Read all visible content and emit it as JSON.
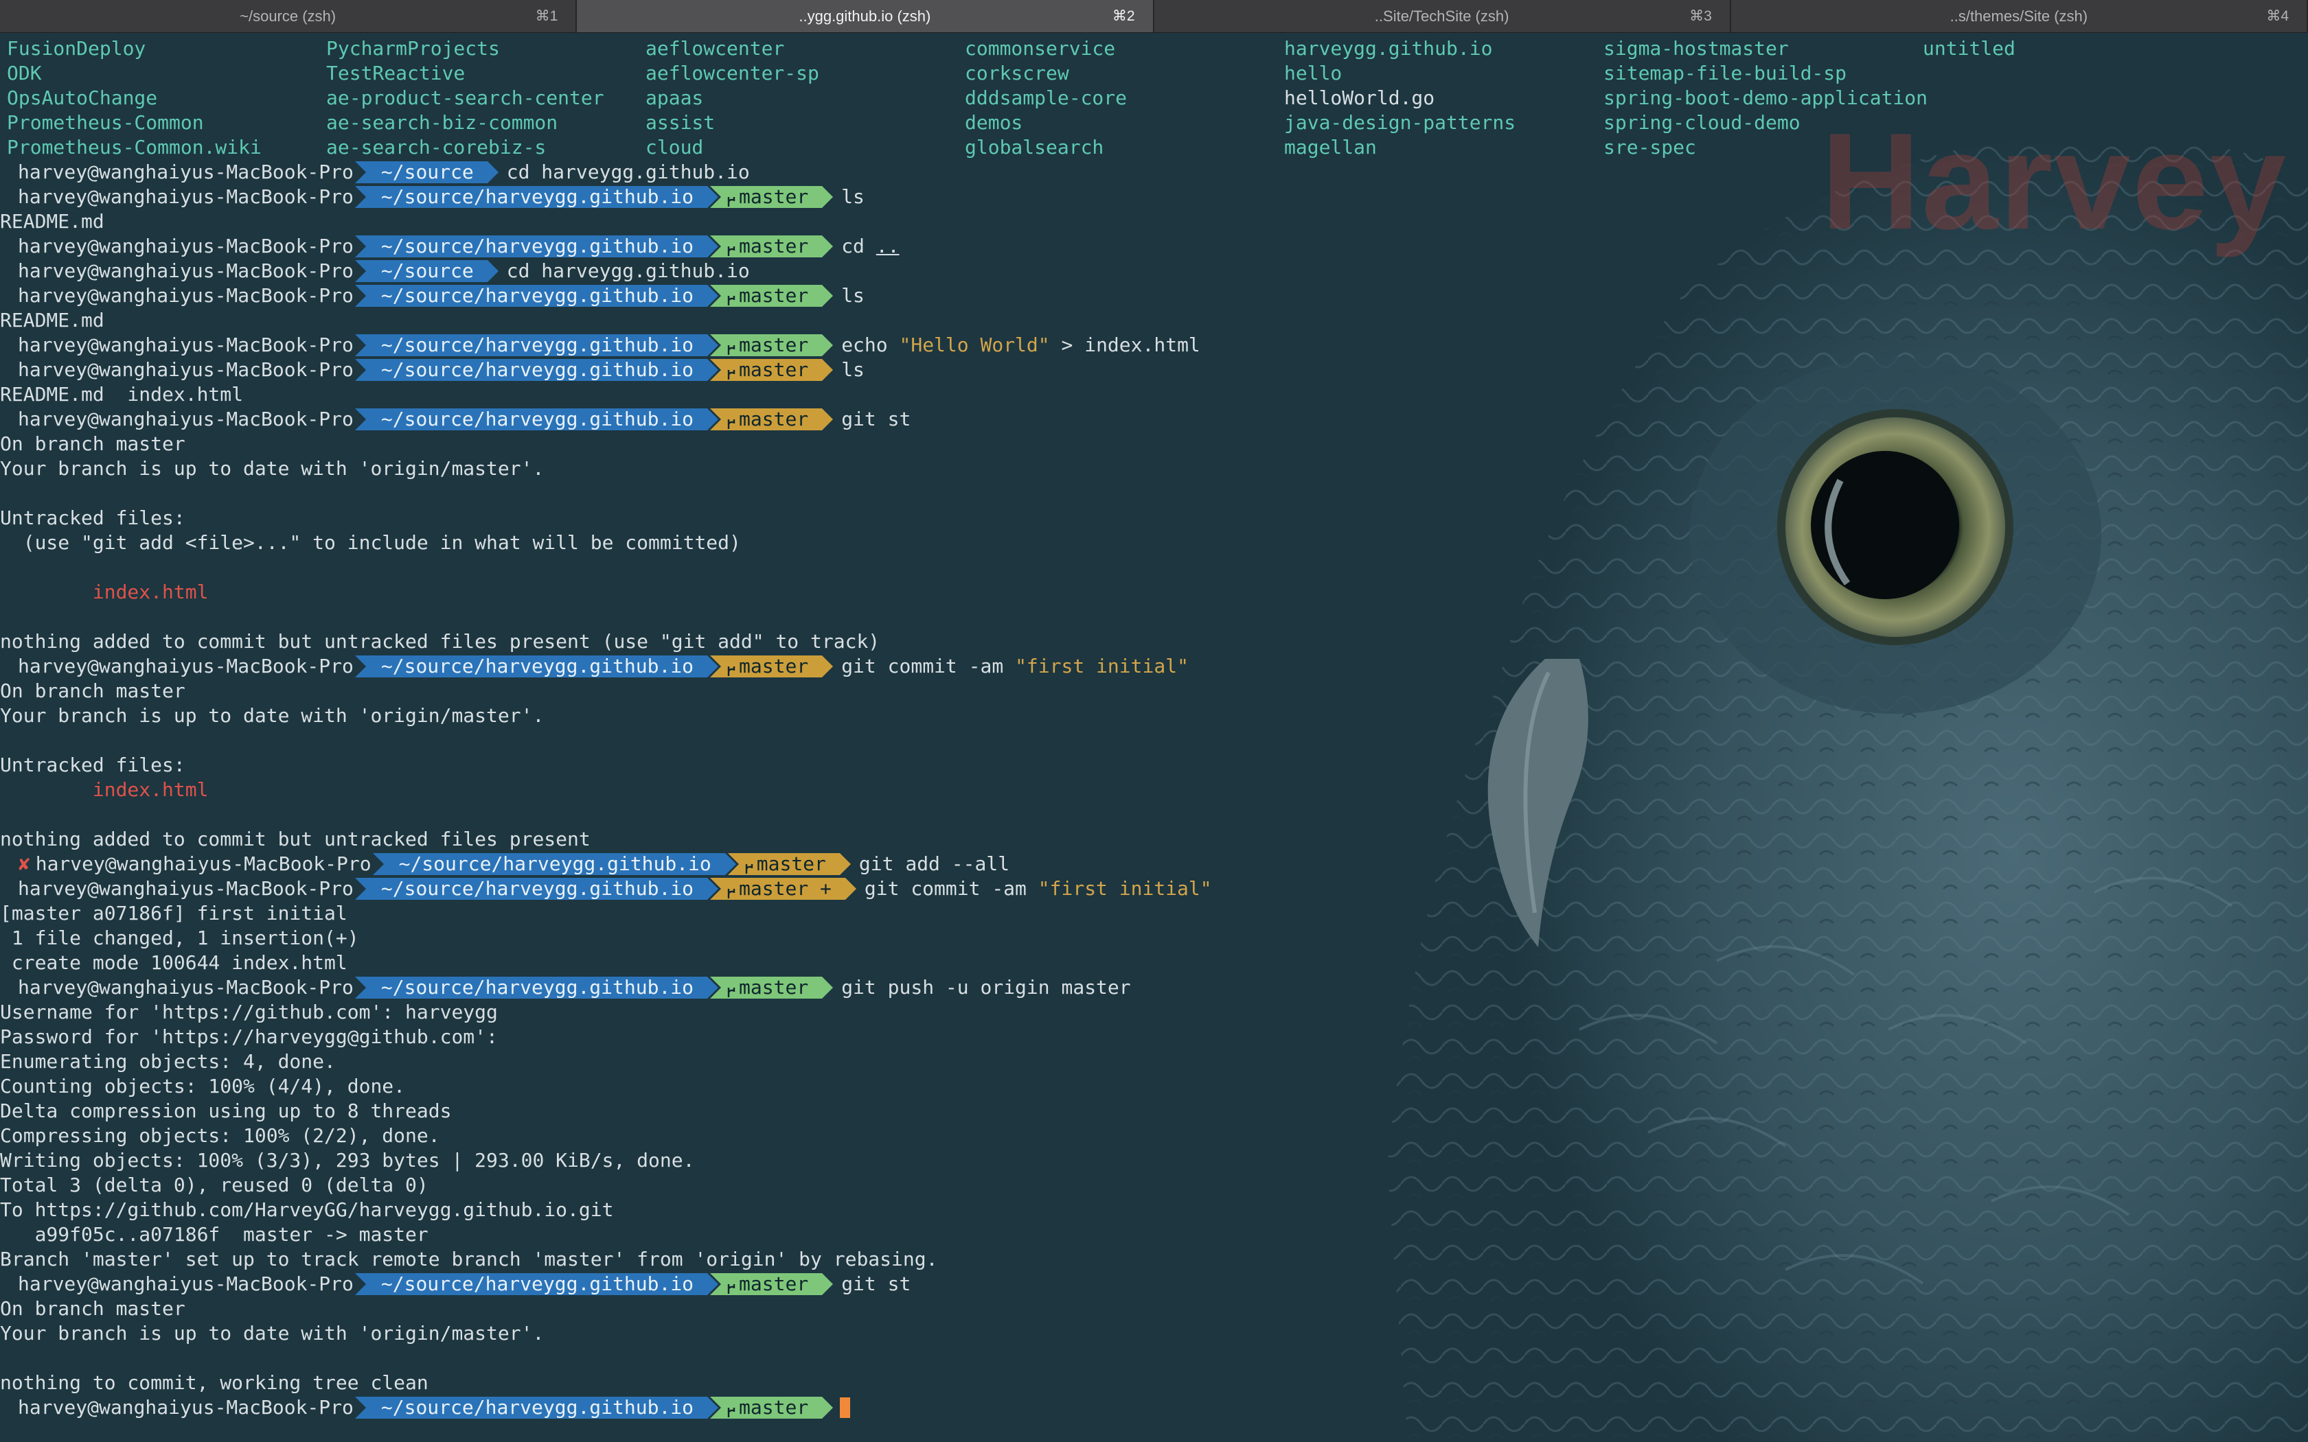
{
  "tabs": [
    {
      "title": "~/source (zsh)",
      "shortcut": "⌘1",
      "active": false
    },
    {
      "title": "..ygg.github.io (zsh)",
      "shortcut": "⌘2",
      "active": true
    },
    {
      "title": "..Site/TechSite (zsh)",
      "shortcut": "⌘3",
      "active": false
    },
    {
      "title": "..s/themes/Site (zsh)",
      "shortcut": "⌘4",
      "active": false
    }
  ],
  "watermark": "Harvey",
  "ls_listing": [
    [
      "FusionDeploy",
      "PycharmProjects",
      "aeflowcenter",
      "commonservice",
      "harveygg.github.io",
      "sigma-hostmaster",
      "untitled"
    ],
    [
      "ODK",
      "TestReactive",
      "aeflowcenter-sp",
      "corkscrew",
      "hello",
      "sitemap-file-build-sp",
      ""
    ],
    [
      "OpsAutoChange",
      "ae-product-search-center",
      "apaas",
      "dddsample-core",
      "helloWorld.go",
      "spring-boot-demo-application",
      ""
    ],
    [
      "Prometheus-Common",
      "ae-search-biz-common",
      "assist",
      "demos",
      "java-design-patterns",
      "spring-cloud-demo",
      ""
    ],
    [
      "Prometheus-Common.wiki",
      "ae-search-corebiz-s",
      "cloud",
      "globalsearch",
      "magellan",
      "sre-spec",
      ""
    ]
  ],
  "prompt_user": "harvey@wanghaiyus-MacBook-Pro",
  "branch": "master",
  "lines": [
    {
      "type": "prompt",
      "path": "~/source",
      "cmd": "cd harveygg.github.io"
    },
    {
      "type": "prompt",
      "path": "~/source/harveygg.github.io",
      "git": "master",
      "git_color": "green",
      "cmd": "ls"
    },
    {
      "type": "out",
      "text": "README.md"
    },
    {
      "type": "prompt",
      "path": "~/source/harveygg.github.io",
      "git": "master",
      "git_color": "green",
      "cmd": "cd ..",
      "underline": true
    },
    {
      "type": "prompt",
      "path": "~/source",
      "cmd": "cd harveygg.github.io"
    },
    {
      "type": "prompt",
      "path": "~/source/harveygg.github.io",
      "git": "master",
      "git_color": "green",
      "cmd": "ls"
    },
    {
      "type": "out",
      "text": "README.md"
    },
    {
      "type": "prompt",
      "path": "~/source/harveygg.github.io",
      "git": "master",
      "git_color": "green",
      "cmd_pre": "echo ",
      "cmd_str": "\"Hello World\"",
      "cmd_post": " > index.html"
    },
    {
      "type": "prompt",
      "path": "~/source/harveygg.github.io",
      "git": "master",
      "git_color": "yellow",
      "cmd": "ls"
    },
    {
      "type": "out",
      "text": "README.md  index.html"
    },
    {
      "type": "prompt",
      "path": "~/source/harveygg.github.io",
      "git": "master",
      "git_color": "yellow",
      "cmd": "git st"
    },
    {
      "type": "out",
      "text": "On branch master"
    },
    {
      "type": "out",
      "text": "Your branch is up to date with 'origin/master'."
    },
    {
      "type": "out",
      "text": ""
    },
    {
      "type": "out",
      "text": "Untracked files:"
    },
    {
      "type": "out",
      "text": "  (use \"git add <file>...\" to include in what will be committed)"
    },
    {
      "type": "out",
      "text": ""
    },
    {
      "type": "red",
      "text": "        index.html"
    },
    {
      "type": "out",
      "text": ""
    },
    {
      "type": "out",
      "text": "nothing added to commit but untracked files present (use \"git add\" to track)"
    },
    {
      "type": "prompt",
      "path": "~/source/harveygg.github.io",
      "git": "master",
      "git_color": "yellow",
      "cmd_pre": "git commit -am ",
      "cmd_str": "\"first initial\"",
      "cmd_post": ""
    },
    {
      "type": "out",
      "text": "On branch master"
    },
    {
      "type": "out",
      "text": "Your branch is up to date with 'origin/master'."
    },
    {
      "type": "out",
      "text": ""
    },
    {
      "type": "out",
      "text": "Untracked files:"
    },
    {
      "type": "red",
      "text": "        index.html"
    },
    {
      "type": "out",
      "text": ""
    },
    {
      "type": "out",
      "text": "nothing added to commit but untracked files present"
    },
    {
      "type": "prompt",
      "error": true,
      "path": "~/source/harveygg.github.io",
      "git": "master",
      "git_color": "yellow",
      "cmd": "git add --all"
    },
    {
      "type": "prompt",
      "path": "~/source/harveygg.github.io",
      "git": "master +",
      "git_color": "yellow",
      "cmd_pre": "git commit -am ",
      "cmd_str": "\"first initial\"",
      "cmd_post": ""
    },
    {
      "type": "out",
      "text": "[master a07186f] first initial"
    },
    {
      "type": "out",
      "text": " 1 file changed, 1 insertion(+)"
    },
    {
      "type": "out",
      "text": " create mode 100644 index.html"
    },
    {
      "type": "prompt",
      "path": "~/source/harveygg.github.io",
      "git": "master",
      "git_color": "green",
      "cmd": "git push -u origin master"
    },
    {
      "type": "out",
      "text": "Username for 'https://github.com': harveygg"
    },
    {
      "type": "out",
      "text": "Password for 'https://harveygg@github.com':"
    },
    {
      "type": "out",
      "text": "Enumerating objects: 4, done."
    },
    {
      "type": "out",
      "text": "Counting objects: 100% (4/4), done."
    },
    {
      "type": "out",
      "text": "Delta compression using up to 8 threads"
    },
    {
      "type": "out",
      "text": "Compressing objects: 100% (2/2), done."
    },
    {
      "type": "out",
      "text": "Writing objects: 100% (3/3), 293 bytes | 293.00 KiB/s, done."
    },
    {
      "type": "out",
      "text": "Total 3 (delta 0), reused 0 (delta 0)"
    },
    {
      "type": "out",
      "text": "To https://github.com/HarveyGG/harveygg.github.io.git"
    },
    {
      "type": "out",
      "text": "   a99f05c..a07186f  master -> master"
    },
    {
      "type": "out",
      "text": "Branch 'master' set up to track remote branch 'master' from 'origin' by rebasing."
    },
    {
      "type": "prompt",
      "path": "~/source/harveygg.github.io",
      "git": "master",
      "git_color": "green",
      "cmd": "git st"
    },
    {
      "type": "out",
      "text": "On branch master"
    },
    {
      "type": "out",
      "text": "Your branch is up to date with 'origin/master'."
    },
    {
      "type": "out",
      "text": ""
    },
    {
      "type": "out",
      "text": "nothing to commit, working tree clean"
    },
    {
      "type": "prompt",
      "path": "~/source/harveygg.github.io",
      "git": "master",
      "git_color": "green",
      "cmd": "",
      "cursor": true
    }
  ],
  "colors": {
    "background": "#1d3640",
    "ls_dir": "#5fc9b3",
    "path_segment": "#2a73b8",
    "git_clean": "#7ec77a",
    "git_dirty": "#cc9e3a",
    "string": "#d3a54a",
    "error": "#e0524a",
    "cursor": "#f08a3a"
  },
  "icons": {
    "branch": "git-branch-icon",
    "error": "cross-mark-icon",
    "background": "owl-wallpaper"
  }
}
